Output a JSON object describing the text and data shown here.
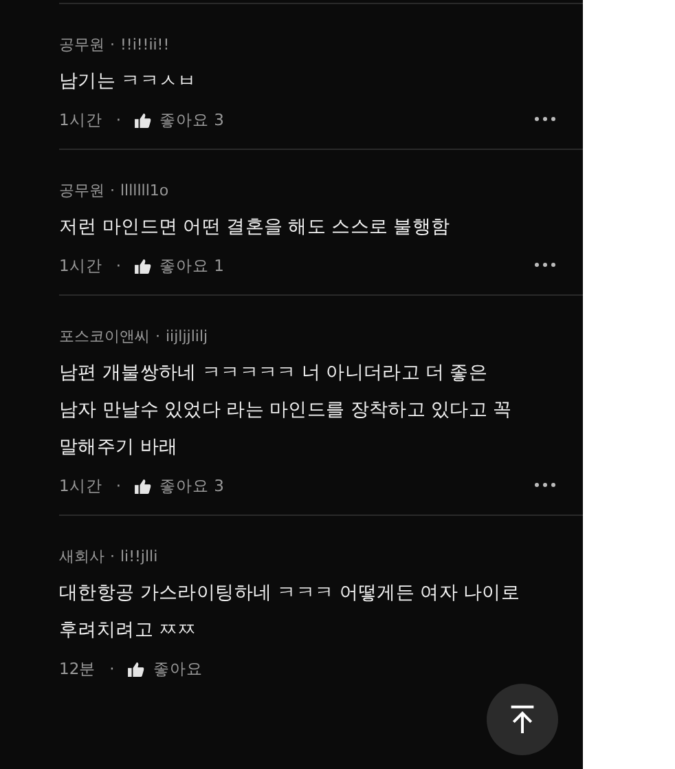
{
  "comments": [
    {
      "author": "공무원",
      "separator": "·",
      "user_id": "!!i!!ii!!",
      "body_lines": [
        "남기는 ㅋㅋㅅㅂ"
      ],
      "time": "1시간",
      "dot": "·",
      "likes": "좋아요 3",
      "has_menu": true
    },
    {
      "author": "공무원",
      "separator": "·",
      "user_id": "lllllll1o",
      "body_lines": [
        "저런 마인드면 어떤 결혼을 해도 스스로 불행함"
      ],
      "time": "1시간",
      "dot": "·",
      "likes": "좋아요 1",
      "has_menu": true
    },
    {
      "author": "포스코이앤씨",
      "separator": "·",
      "user_id": "iijljjlilj",
      "body_lines": [
        "남편 개불쌍하네 ㅋㅋㅋㅋㅋ 너 아니더라고 더 좋은",
        "남자 만날수 있었다 라는 마인드를 장착하고 있다고 꼭",
        "말해주기 바래"
      ],
      "time": "1시간",
      "dot": "·",
      "likes": "좋아요 3",
      "has_menu": true
    },
    {
      "author": "새회사",
      "separator": "·",
      "user_id": "li!!jlli",
      "body_lines": [
        "대한항공 가스라이팅하네 ㅋㅋㅋ 어떻게든 여자 나이로",
        "후려치려고 ㅉㅉ"
      ],
      "time": "12분",
      "dot": "·",
      "likes": "좋아요",
      "has_menu": false
    }
  ]
}
